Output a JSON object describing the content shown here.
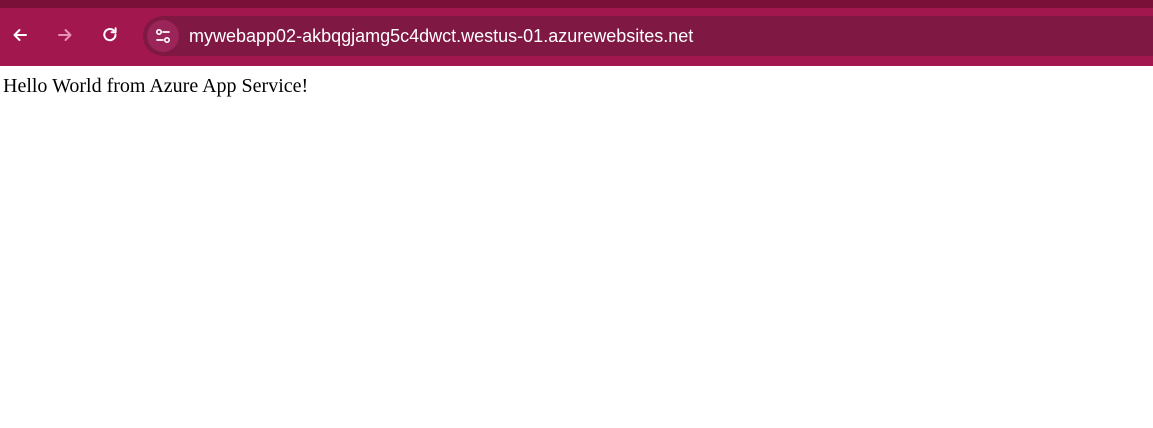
{
  "browser": {
    "address_bar": {
      "url": "mywebapp02-akbqgjamg5c4dwct.westus-01.azurewebsites.net"
    },
    "buttons": {
      "back_icon": "arrow-left",
      "forward_icon": "arrow-right",
      "reload_icon": "refresh"
    },
    "colors": {
      "toolbar": "#a3174f",
      "omnibox": "#7f1842",
      "top_strip": "#7a0f37"
    }
  },
  "page": {
    "body_text": "Hello World from Azure App Service!"
  }
}
